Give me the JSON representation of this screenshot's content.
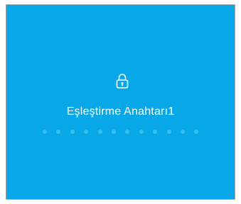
{
  "screen": {
    "title": "Eşleştirme Anahtarı1",
    "icon": "lock-icon",
    "key_length": 12,
    "entered": 0
  },
  "colors": {
    "background": "#07a7e8",
    "text": "#ffffff",
    "dot": "#3fc0f0"
  }
}
